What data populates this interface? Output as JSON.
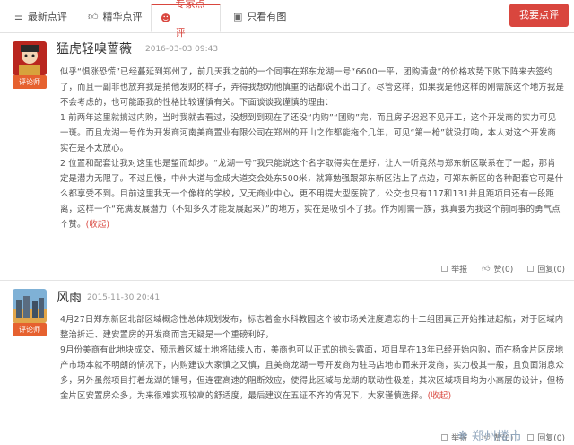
{
  "tabs": [
    {
      "label": "最新点评",
      "icon": "list-icon"
    },
    {
      "label": "精华点评",
      "icon": "thumbs-up-icon"
    },
    {
      "label": "专家点评",
      "icon": "user-icon",
      "active": true
    },
    {
      "label": "只看有图",
      "icon": "image-icon"
    }
  ],
  "write_review_label": "我要点评",
  "accent_color": "#d9463e",
  "reviews": [
    {
      "user": "猛虎轻嗅蔷薇",
      "badge": "评论师",
      "date": "2016-03-03 09:43",
      "paragraphs": [
        "似乎“惧涨恐慌”已经蔓延到郑州了，前几天我之前的一个同事在郑东龙湖一号“6600一平，团购清盘”的价格攻势下败下阵来去签约了，而且一副非也放弃我是捎他发财的样子，弄得我想劝他慎重的话都说不出口了。尽管这样，如果我是他这样的刚需族这个地方我是不会考虑的，也可能跟我的性格比较谨慎有关。下面谈谈我谨慎的理由：",
        "1 前两年这里就搞过内购，当时我就去看过，没想到到现在了还没“内购”“团购”完，而且房子迟迟不见开工，这个开发商的实力可见一斑。而且龙湖一号作为开发商河南美商置业有限公司在郑州的开山之作都能拖个几年，可见“第一枪”就没打响，本人对这个开发商实在是不太放心。",
        "2 位置和配套让我对这里也是望而却步。“龙湖一号”我只能说这个名字取得实在是好，让人一听竟然与郑东新区联系在了一起，那肯定是潜力无限了。不过且慢，中州大道与金成大道交会处东500米，就算勉强跟郑东新区沾上了点边，可郑东新区的各种配套它可是什么都享受不到。目前这里我无一个像样的学校，又无商业中心，更不用提大型医院了，公交也只有117和131并且距项目还有一段距离，这样一个“充满发展潜力（不知多久才能发展起来）”的地方，实在是吸引不了我。作为刚需一族，我真要为我这个前同事的勇气点个赞。"
      ],
      "collapse_label": "(收起)"
    },
    {
      "user": "风雨",
      "badge": "评论师",
      "date": "2015-11-30 20:41",
      "paragraphs": [
        "4月27日郑东新区北部区域概念性总体规划发布，标志着金水科教园这个被市场关注度遗忘的十二组团真正开始推进起航，对于区域内整治拆迁、建安置房的开发商而言无疑是一个重磅利好，",
        "9月份美商有此地块成交，预示着区域土地将陆续入市，美商也可以正式的抛头露面，项目早在13年已经开始内购，而在杨金片区房地产市场本就不明朗的情况下，内购建议大家慎之又慎，且美商龙湖一号开发商为驻马店地市而来开发商，实力极其一般，且负面消息众多，另外虽然项目打着龙湖的镶号，但连霍高速的阻断效应，使得此区域与龙湖的联动性极差，其次区域项目均为小高层的设计，但杨金片区安置房众多，为来很难实现较高的舒适度，最后建议在五证不齐的情况下，大家谨慎选择。"
      ],
      "collapse_label": "(收起)"
    }
  ],
  "actions": {
    "report": "举报",
    "like": "赞(0)",
    "reply": "回复(0)"
  },
  "watermark": "郑州楼市"
}
